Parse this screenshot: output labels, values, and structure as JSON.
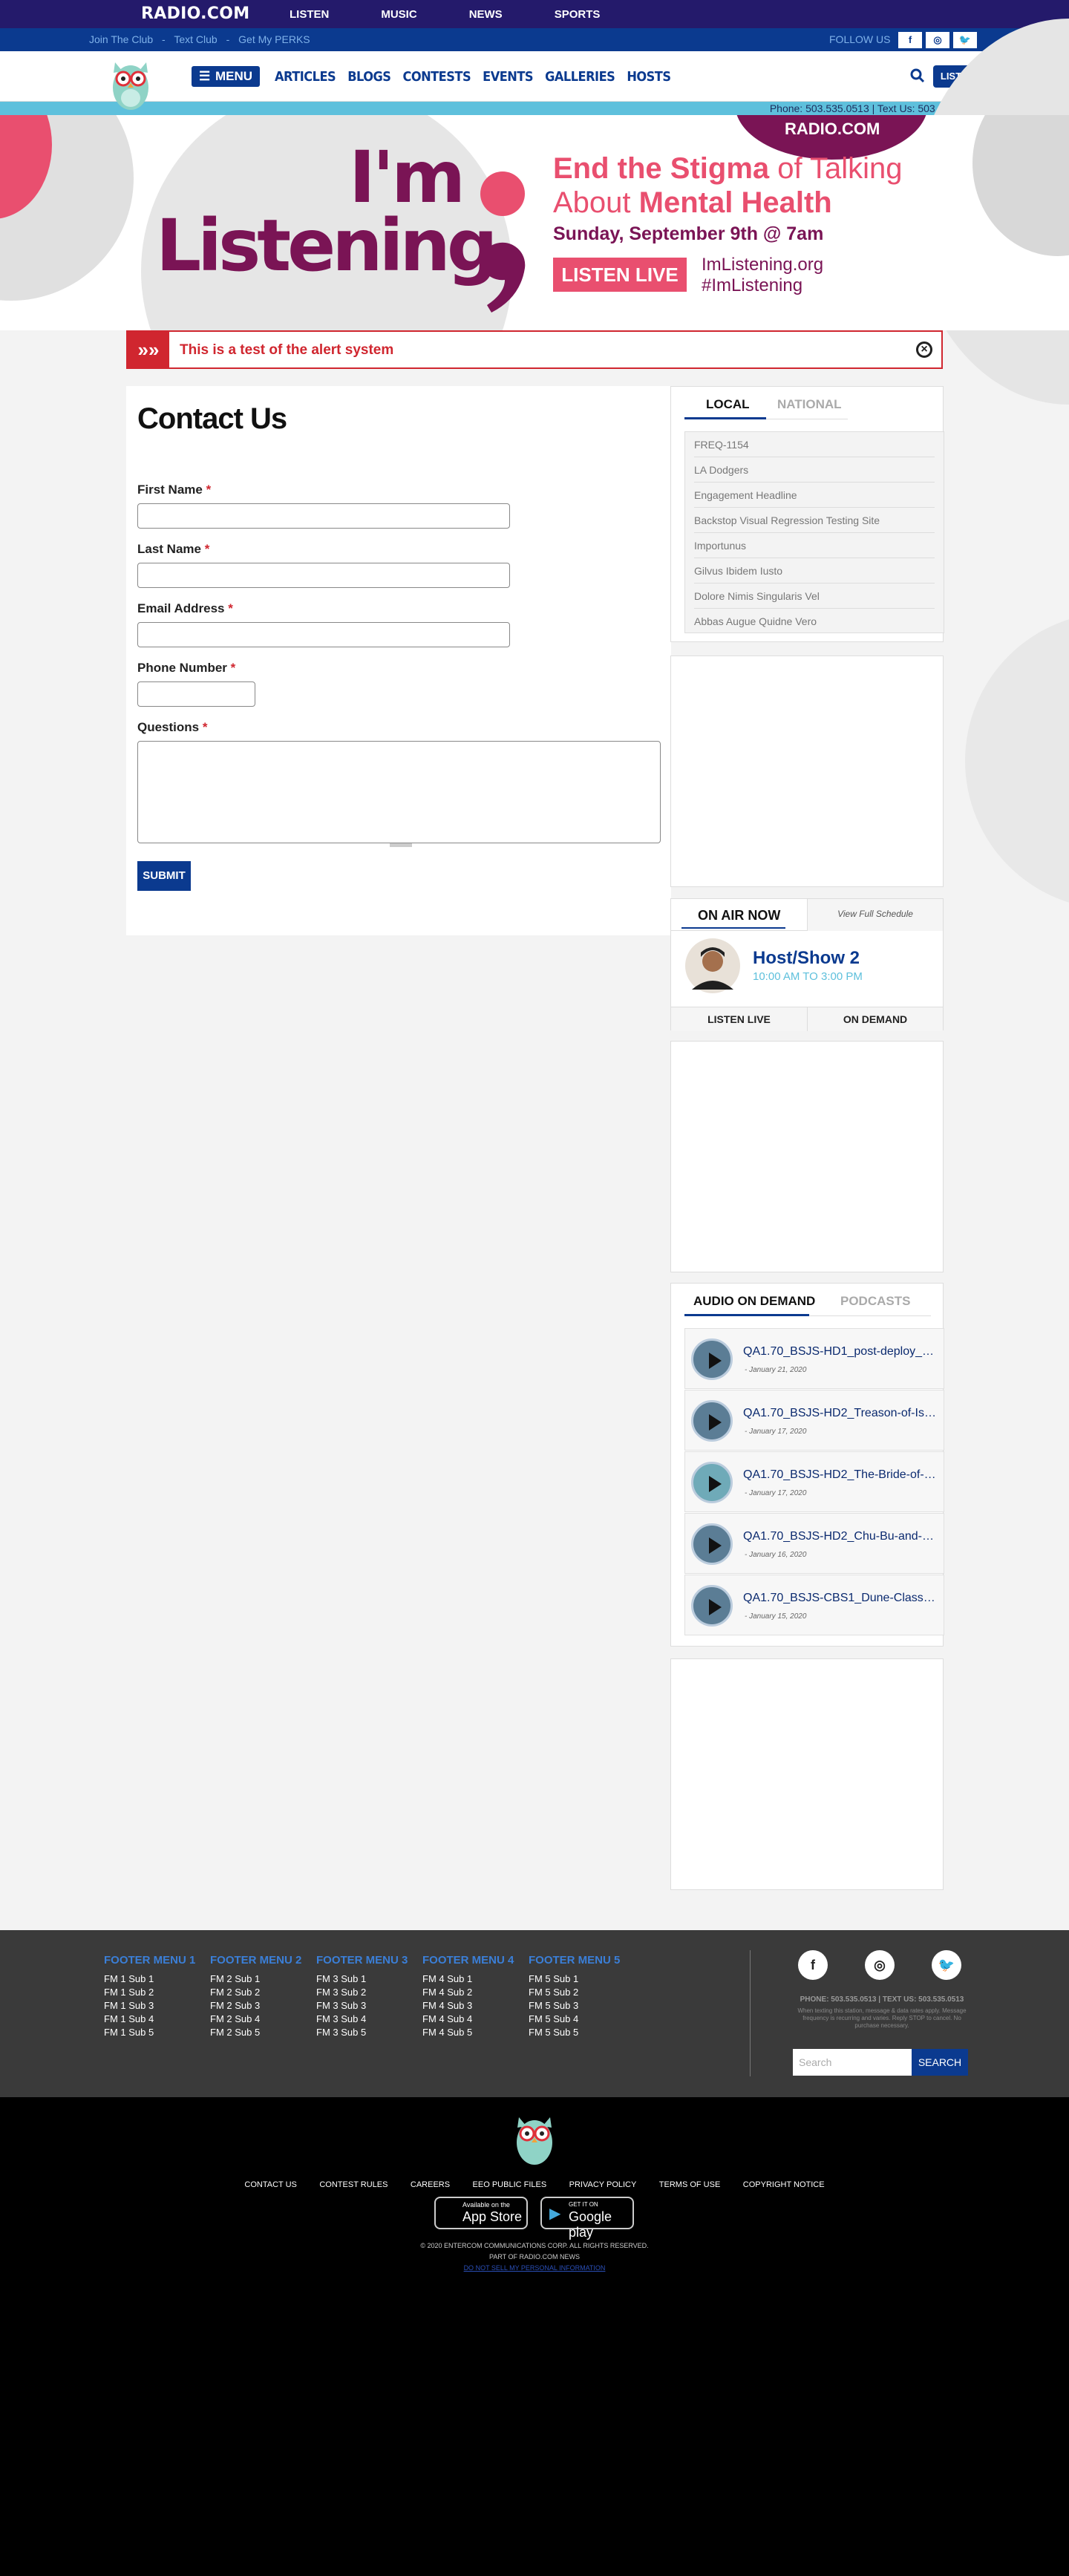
{
  "topbar": {
    "logo": "RADIO.COM",
    "nav": [
      "LISTEN",
      "MUSIC",
      "NEWS",
      "SPORTS"
    ]
  },
  "subbar": {
    "links": [
      "Join The Club",
      "-",
      "Text Club",
      "-",
      "Get My PERKS"
    ],
    "follow": "FOLLOW US"
  },
  "mainnav": {
    "menu": "MENU",
    "links": [
      "ARTICLES",
      "BLOGS",
      "CONTESTS",
      "EVENTS",
      "GALLERIES",
      "HOSTS"
    ],
    "listen": "LISTEN"
  },
  "phonebar": "Phone: 503.535.0513 | Text Us: 503.535.0513",
  "hero": {
    "brand": "RADIO.COM",
    "im": "I'm",
    "listening": "Listening",
    "line1a": "End the Stigma",
    "line1b": " of Talking",
    "line2a": "About ",
    "line2b": "Mental Health",
    "date": "Sunday, September 9th @ 7am",
    "cta": "LISTEN LIVE",
    "site": "ImListening.org",
    "tag": "#ImListening"
  },
  "alert": {
    "text": "This is a test of the alert system"
  },
  "contact": {
    "title": "Contact Us",
    "fields": [
      "First Name",
      "Last Name",
      "Email Address",
      "Phone Number",
      "Questions"
    ],
    "required": "*",
    "submit": "SUBMIT"
  },
  "trending": {
    "tabs": [
      "LOCAL",
      "NATIONAL"
    ],
    "items": [
      "FREQ-1154",
      "LA Dodgers",
      "Engagement Headline",
      "Backstop Visual Regression Testing Site",
      "Importunus",
      "Gilvus Ibidem Iusto",
      "Dolore Nimis Singularis Vel",
      "Abbas Augue Quidne Vero"
    ]
  },
  "onair": {
    "title": "ON AIR NOW",
    "schedule": "View Full Schedule",
    "host": "Host/Show 2",
    "time": "10:00 AM TO 3:00 PM",
    "listen": "LISTEN LIVE",
    "demand": "ON DEMAND"
  },
  "audio": {
    "tabs": [
      "AUDIO ON DEMAND",
      "PODCASTS"
    ],
    "items": [
      {
        "title": "QA1.70_BSJS-HD1_post-deploy_The...",
        "date": "- January 21, 2020"
      },
      {
        "title": "QA1.70_BSJS-HD2_Treason-of-Isen...",
        "date": "- January 17, 2020"
      },
      {
        "title": "QA1.70_BSJS-HD2_The-Bride-of-the...",
        "date": "- January 17, 2020"
      },
      {
        "title": "QA1.70_BSJS-HD2_Chu-Bu-and-She...",
        "date": "- January 16, 2020"
      },
      {
        "title": "QA1.70_BSJS-CBS1_Dune-Class-1_...",
        "date": "- January 15, 2020"
      }
    ]
  },
  "footer": {
    "menus": [
      {
        "title": "FOOTER MENU 1",
        "items": [
          "FM 1 Sub 1",
          "FM 1 Sub 2",
          "FM 1 Sub 3",
          "FM 1 Sub 4",
          "FM 1 Sub 5"
        ]
      },
      {
        "title": "FOOTER MENU 2",
        "items": [
          "FM 2 Sub 1",
          "FM 2 Sub 2",
          "FM 2 Sub 3",
          "FM 2 Sub 4",
          "FM 2 Sub 5"
        ]
      },
      {
        "title": "FOOTER MENU 3",
        "items": [
          "FM 3 Sub 1",
          "FM 3 Sub 2",
          "FM 3 Sub 3",
          "FM 3 Sub 4",
          "FM 3 Sub 5"
        ]
      },
      {
        "title": "FOOTER MENU 4",
        "items": [
          "FM 4 Sub 1",
          "FM 4 Sub 2",
          "FM 4 Sub 3",
          "FM 4 Sub 4",
          "FM 4 Sub 5"
        ]
      },
      {
        "title": "FOOTER MENU 5",
        "items": [
          "FM 5 Sub 1",
          "FM 5 Sub 2",
          "FM 5 Sub 3",
          "FM 5 Sub 4",
          "FM 5 Sub 5"
        ]
      }
    ],
    "phone": "PHONE: 503.535.0513 | TEXT US: 503.535.0513",
    "disclaimer": "When texting this station, message & data rates apply. Message frequency is recurring and varies. Reply STOP to cancel. No purchase necessary.",
    "search_placeholder": "Search",
    "search_btn": "SEARCH"
  },
  "bottom": {
    "links": [
      "CONTACT US",
      "CONTEST RULES",
      "CAREERS",
      "EEO PUBLIC FILES",
      "PRIVACY POLICY",
      "TERMS OF USE",
      "COPYRIGHT NOTICE"
    ],
    "appstore_small": "Available on the",
    "appstore": "App Store",
    "gplay_small": "GET IT ON",
    "gplay": "Google play",
    "copyright": "© 2020 ENTERCOM COMMUNICATIONS CORP. ALL RIGHTS RESERVED.",
    "part": "PART OF RADIO.COM NEWS",
    "donotsell": "DO NOT SELL MY PERSONAL INFORMATION"
  }
}
